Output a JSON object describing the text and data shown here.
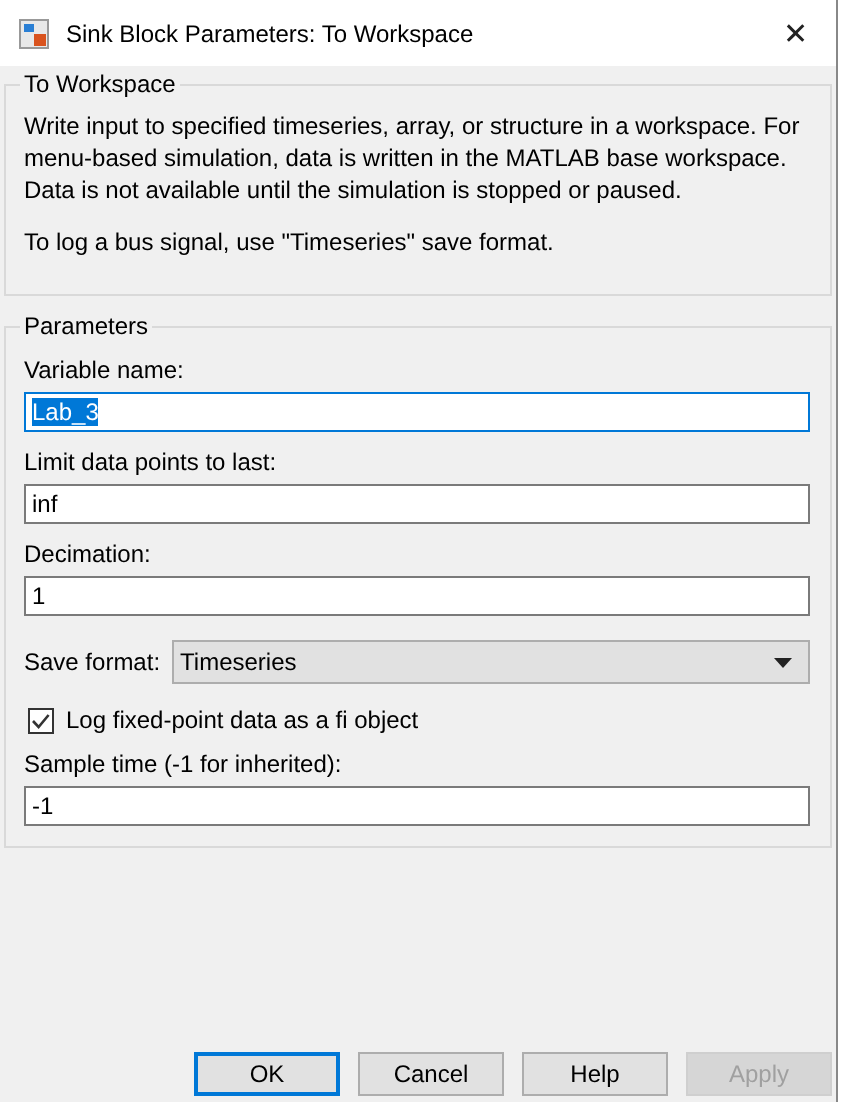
{
  "window": {
    "title": "Sink Block Parameters: To Workspace",
    "close": "✕"
  },
  "description": {
    "title": "To Workspace",
    "paragraphs": [
      "Write input to specified timeseries, array, or structure in a workspace. For menu-based simulation, data is written in the MATLAB base workspace. Data is not available until the simulation is stopped or paused.",
      "To log a bus signal, use \"Timeseries\" save format."
    ]
  },
  "parameters": {
    "title": "Parameters",
    "items": [
      {
        "kind": "text",
        "label": "Variable name:",
        "value": "Lab_3",
        "focused": true
      },
      {
        "kind": "text",
        "label": "Limit data points to last:",
        "value": "inf",
        "focused": false
      },
      {
        "kind": "text",
        "label": "Decimation:",
        "value": "1",
        "focused": false
      },
      {
        "kind": "dropdown",
        "label": "Save format:",
        "value": "Timeseries"
      },
      {
        "kind": "checkbox",
        "label": "Log fixed-point data as a fi object",
        "checked": true
      },
      {
        "kind": "text",
        "label": "Sample time (-1 for inherited):",
        "value": "-1",
        "focused": false
      }
    ]
  },
  "buttons": [
    {
      "label": "OK",
      "default": true,
      "disabled": false
    },
    {
      "label": "Cancel",
      "default": false,
      "disabled": false
    },
    {
      "label": "Help",
      "default": false,
      "disabled": false
    },
    {
      "label": "Apply",
      "default": false,
      "disabled": true
    }
  ]
}
